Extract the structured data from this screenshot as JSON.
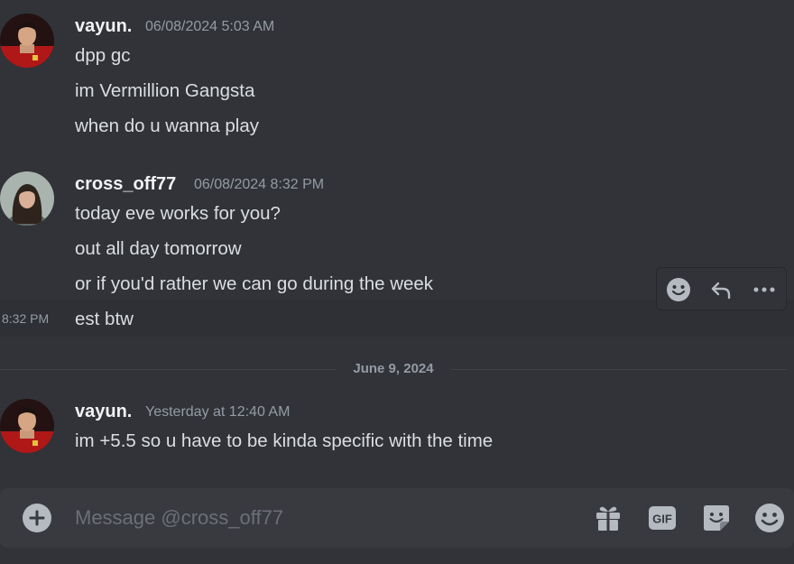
{
  "messages": [
    {
      "username": "vayun.",
      "timestamp": "06/08/2024 5:03 AM",
      "lines": [
        "dpp gc",
        "im Vermillion Gangsta",
        "when do u wanna play"
      ]
    },
    {
      "username": "cross_off77",
      "timestamp": "06/08/2024 8:32 PM",
      "lines": [
        "today eve works for you?",
        "out all day tomorrow",
        "or if you'd rather we can go during the week",
        "est btw"
      ],
      "hover_time": "8:32 PM"
    },
    {
      "username": "vayun.",
      "timestamp": "Yesterday at 12:40 AM",
      "lines": [
        "im +5.5 so u have to be kinda specific with the time"
      ]
    }
  ],
  "date_divider": "June 9, 2024",
  "composer": {
    "placeholder": "Message @cross_off77",
    "gif_label": "GIF"
  },
  "message_toolbar": {
    "icons": [
      "add-reaction-icon",
      "reply-icon",
      "more-options-icon"
    ]
  },
  "composer_icons": [
    "plus-icon",
    "gift-icon",
    "gif-icon",
    "sticker-icon",
    "emoji-icon"
  ],
  "colors": {
    "background": "#313338",
    "composer": "#383a40",
    "text": "#dbdee1",
    "muted": "#949ba4",
    "username": "#f2f3f5",
    "icon": "#b5bac1"
  }
}
